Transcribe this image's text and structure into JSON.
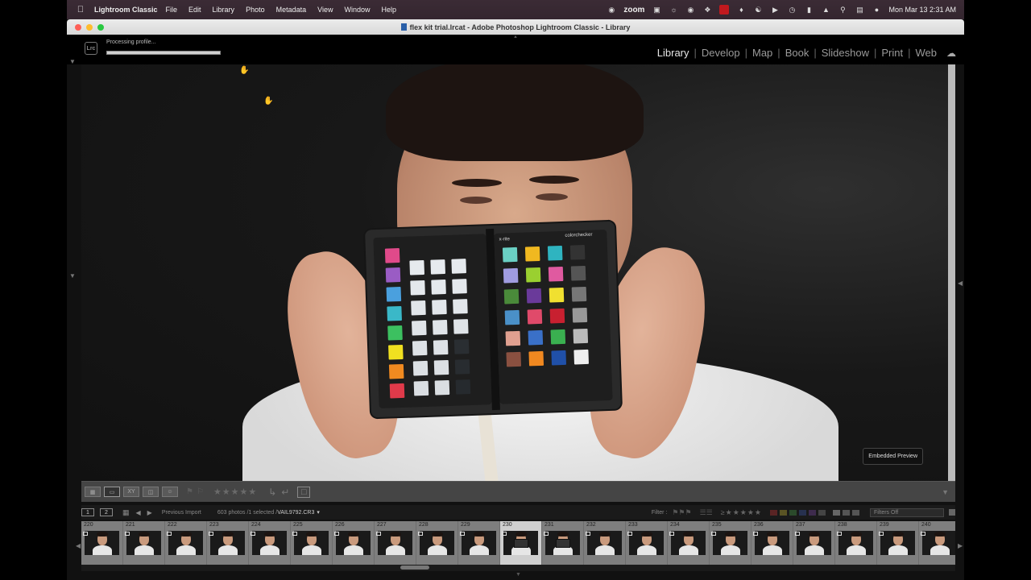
{
  "menubar": {
    "app_name": "Lightroom Classic",
    "menus": [
      "File",
      "Edit",
      "Library",
      "Photo",
      "Metadata",
      "View",
      "Window",
      "Help"
    ],
    "zoom_label": "zoom",
    "datetime": "Mon Mar 13  2:31 AM"
  },
  "window": {
    "title": "flex kit trial.lrcat - Adobe Photoshop Lightroom Classic - Library"
  },
  "topbar": {
    "logo": "Lrc",
    "processing_text": "Processing profile...",
    "progress_percent": 100,
    "modules": [
      {
        "label": "Library",
        "active": true
      },
      {
        "label": "Develop",
        "active": false
      },
      {
        "label": "Map",
        "active": false
      },
      {
        "label": "Book",
        "active": false
      },
      {
        "label": "Slideshow",
        "active": false
      },
      {
        "label": "Print",
        "active": false
      },
      {
        "label": "Web",
        "active": false
      }
    ]
  },
  "viewer": {
    "embedded_preview_label": "Embedded Preview",
    "checker_brand_left": "x-rite",
    "checker_brand_right": "colorchecker"
  },
  "filmstrip_header": {
    "view1": "1",
    "view2": "2",
    "source": "Previous Import",
    "count": "603 photos /1 selected /",
    "filename": "VAIL9792.CR3",
    "filter_label": "Filter :",
    "filters_off": "Filters Off"
  },
  "filmstrip": {
    "selected_index": 10,
    "cells": [
      "220",
      "221",
      "222",
      "223",
      "224",
      "225",
      "226",
      "227",
      "228",
      "229",
      "230",
      "231",
      "232",
      "233",
      "234",
      "235",
      "236",
      "237",
      "238",
      "239",
      "240"
    ]
  },
  "colors": {
    "accent_selected": "#cfcfcf",
    "menubar_bg": "#3b2b35",
    "panel_bg": "#454545"
  }
}
